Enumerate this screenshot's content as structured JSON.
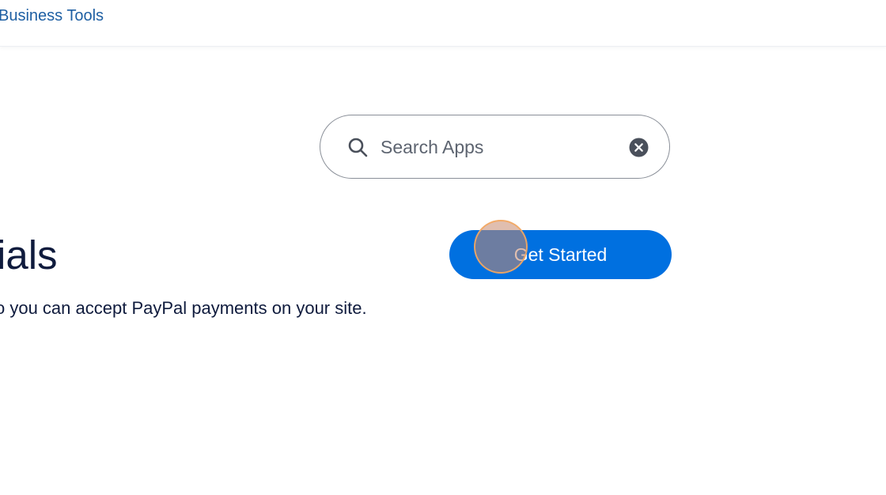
{
  "topbar": {
    "link_label": "Business Tools"
  },
  "search": {
    "placeholder": "Search Apps",
    "value": ""
  },
  "main": {
    "heading_fragment": "ials",
    "description_fragment": "o you can accept PayPal payments on your site.",
    "cta_label": "Get Started"
  },
  "icons": {
    "search": "search-icon",
    "clear": "close-circle-icon"
  },
  "colors": {
    "link": "#1e5fa3",
    "primary_button": "#0070e0",
    "heading_text": "#0f1b3d",
    "search_text": "#5d6470",
    "clear_icon": "#4a505b"
  }
}
